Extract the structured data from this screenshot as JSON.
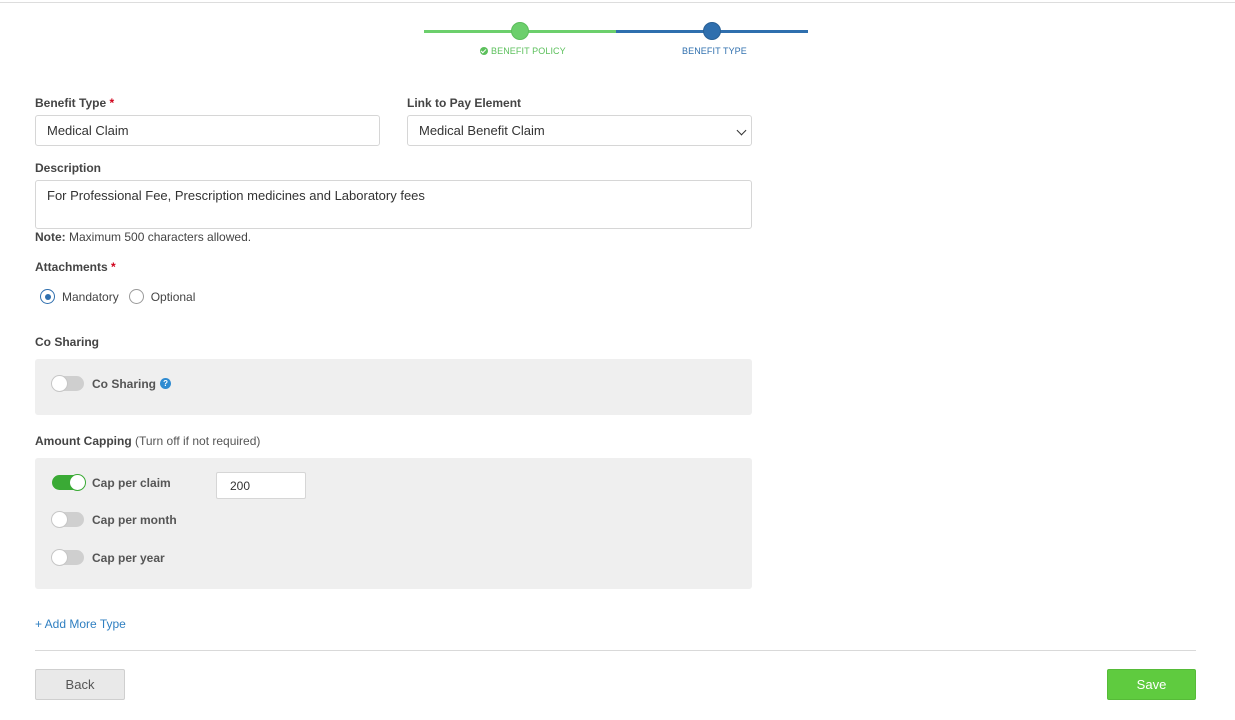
{
  "stepper": {
    "steps": [
      {
        "label": "BENEFIT POLICY",
        "state": "completed"
      },
      {
        "label": "BENEFIT TYPE",
        "state": "active"
      }
    ]
  },
  "form": {
    "benefit_type": {
      "label": "Benefit Type",
      "required_mark": "*",
      "value": "Medical Claim"
    },
    "pay_element": {
      "label": "Link to Pay Element",
      "selected": "Medical Benefit Claim"
    },
    "description": {
      "label": "Description",
      "value": "For Professional Fee, Prescription medicines and Laboratory fees",
      "note_bold": "Note:",
      "note_text": " Maximum 500 characters allowed."
    },
    "attachments": {
      "label": "Attachments",
      "required_mark": "*",
      "options": [
        {
          "label": "Mandatory",
          "checked": true
        },
        {
          "label": "Optional",
          "checked": false
        }
      ]
    },
    "co_sharing": {
      "section_label": "Co Sharing",
      "toggle_label": "Co Sharing",
      "enabled": false,
      "help_glyph": "?"
    },
    "amount_capping": {
      "label": "Amount Capping",
      "hint": " (Turn off if not required)",
      "rows": [
        {
          "label": "Cap per claim",
          "enabled": true,
          "value": "200"
        },
        {
          "label": "Cap per month",
          "enabled": false
        },
        {
          "label": "Cap per year",
          "enabled": false
        }
      ]
    },
    "add_more_link": "+ Add More Type"
  },
  "footer": {
    "back_label": "Back",
    "save_label": "Save"
  },
  "colors": {
    "accent_blue": "#2f6fae",
    "success_green": "#5fcb3f",
    "required_red": "#d0021b"
  }
}
